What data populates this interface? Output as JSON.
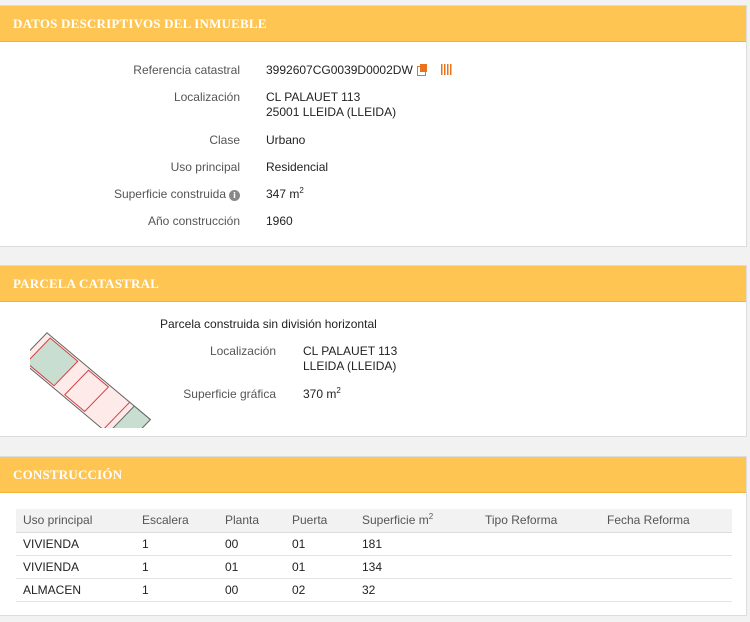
{
  "inmueble": {
    "title": "DATOS DESCRIPTIVOS DEL INMUEBLE",
    "referencia_label": "Referencia catastral",
    "referencia_value": "3992607CG0039D0002DW",
    "localizacion_label": "Localización",
    "localizacion_line1": "CL PALAUET 113",
    "localizacion_line2": "25001 LLEIDA (LLEIDA)",
    "clase_label": "Clase",
    "clase_value": "Urbano",
    "uso_label": "Uso principal",
    "uso_value": "Residencial",
    "superficie_label": "Superficie construida",
    "superficie_value": "347 m",
    "superficie_unit_exp": "2",
    "anio_label": "Año construcción",
    "anio_value": "1960"
  },
  "parcela": {
    "title": "PARCELA CATASTRAL",
    "descripcion": "Parcela construida sin división horizontal",
    "localizacion_label": "Localización",
    "localizacion_line1": "CL PALAUET 113",
    "localizacion_line2": "LLEIDA (LLEIDA)",
    "superficie_label": "Superficie gráfica",
    "superficie_value": "370 m",
    "superficie_unit_exp": "2"
  },
  "construccion": {
    "title": "CONSTRUCCIÓN",
    "headers": [
      "Uso principal",
      "Escalera",
      "Planta",
      "Puerta",
      "Superficie m",
      "Tipo Reforma",
      "Fecha Reforma"
    ],
    "superficie_header_exp": "2",
    "rows": [
      [
        "VIVIENDA",
        "1",
        "00",
        "01",
        "181",
        "",
        ""
      ],
      [
        "VIVIENDA",
        "1",
        "01",
        "01",
        "134",
        "",
        ""
      ],
      [
        "ALMACEN",
        "1",
        "00",
        "02",
        "32",
        "",
        ""
      ]
    ]
  },
  "icons": {
    "info": "info-icon",
    "copy": "copy-icon",
    "barcode": "barcode-icon",
    "parcel_map": "parcel-map"
  },
  "colors": {
    "header_bg": "#ffc552",
    "accent": "#e8731c"
  }
}
